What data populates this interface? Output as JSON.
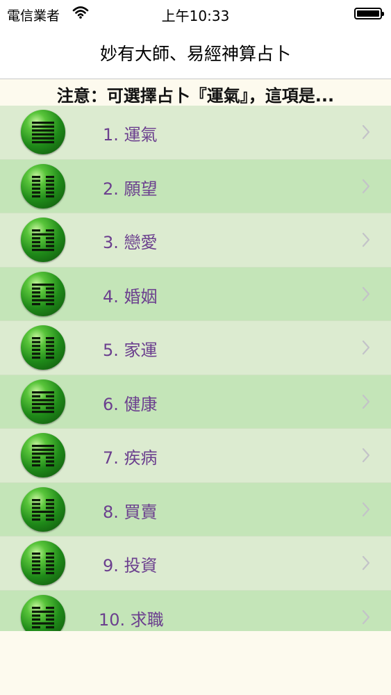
{
  "status_bar": {
    "carrier": "電信業者",
    "time": "上午10:33"
  },
  "nav": {
    "title": "妙有大師、易經神算占卜"
  },
  "notice": {
    "text": "注意：可選擇占卜『運氣』，這項是..."
  },
  "items": [
    {
      "label": "1. 運氣",
      "lines": [
        1,
        1,
        1,
        1,
        1,
        1
      ]
    },
    {
      "label": "2. 願望",
      "lines": [
        0,
        0,
        0,
        0,
        0,
        0
      ]
    },
    {
      "label": "3. 戀愛",
      "lines": [
        0,
        1,
        0,
        0,
        0,
        1
      ]
    },
    {
      "label": "4. 婚姻",
      "lines": [
        1,
        0,
        0,
        0,
        1,
        0
      ]
    },
    {
      "label": "5. 家運",
      "lines": [
        0,
        0,
        0,
        0,
        0,
        0
      ]
    },
    {
      "label": "6. 健康",
      "lines": [
        1,
        0,
        1,
        1,
        0,
        1
      ]
    },
    {
      "label": "7. 疾病",
      "lines": [
        1,
        1,
        1,
        0,
        0,
        0
      ]
    },
    {
      "label": "8. 買賣",
      "lines": [
        0,
        0,
        0,
        1,
        0,
        0
      ]
    },
    {
      "label": "9. 投資",
      "lines": [
        0,
        0,
        0,
        0,
        0,
        0
      ]
    },
    {
      "label": "10. 求職",
      "lines": [
        0,
        1,
        0,
        0,
        1,
        0
      ]
    }
  ]
}
